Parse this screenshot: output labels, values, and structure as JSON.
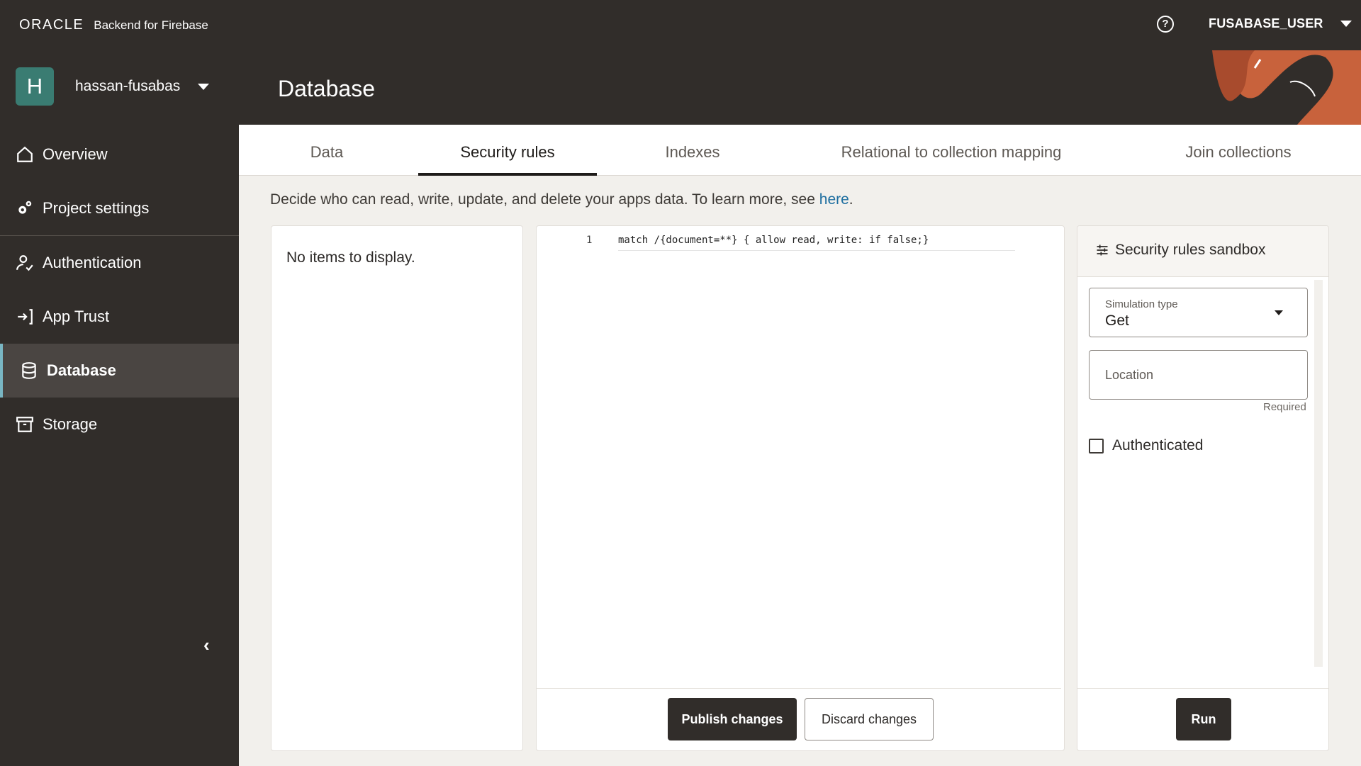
{
  "topbar": {
    "brand_logo": "ORACLE",
    "brand_product": "Backend for Firebase",
    "help_icon": "?",
    "user_name": "FUSABASE_USER"
  },
  "sidebar": {
    "project_initial": "H",
    "project_name": "hassan-fusabas",
    "items": [
      {
        "label": "Overview",
        "icon": "home-icon"
      },
      {
        "label": "Project settings",
        "icon": "gears-icon"
      },
      {
        "label": "Authentication",
        "icon": "user-check-icon"
      },
      {
        "label": "App Trust",
        "icon": "sign-in-icon"
      },
      {
        "label": "Database",
        "icon": "database-icon",
        "active": true
      },
      {
        "label": "Storage",
        "icon": "archive-icon"
      }
    ],
    "collapse_icon": "‹"
  },
  "header": {
    "title": "Database"
  },
  "tabs": [
    {
      "label": "Data"
    },
    {
      "label": "Security rules",
      "active": true
    },
    {
      "label": "Indexes"
    },
    {
      "label": "Relational to collection mapping"
    },
    {
      "label": "Join collections"
    }
  ],
  "description": {
    "text": "Decide who can read, write, update, and delete your apps data. To learn more, see",
    "link": "here",
    "period": "."
  },
  "history_panel": {
    "empty_text": "No items to display."
  },
  "editor": {
    "line_number": "1",
    "code": "match /{document=**} { allow read, write: if false;}",
    "publish_label": "Publish changes",
    "discard_label": "Discard changes"
  },
  "sandbox": {
    "title": "Security rules sandbox",
    "simulation_label": "Simulation type",
    "simulation_value": "Get",
    "location_placeholder": "Location",
    "required_text": "Required",
    "authenticated_label": "Authenticated",
    "run_label": "Run"
  },
  "colors": {
    "dark": "#312d2a",
    "accent_link": "#1f6fa0",
    "active_indicator": "#79b6c3",
    "avatar": "#3a7c72"
  }
}
